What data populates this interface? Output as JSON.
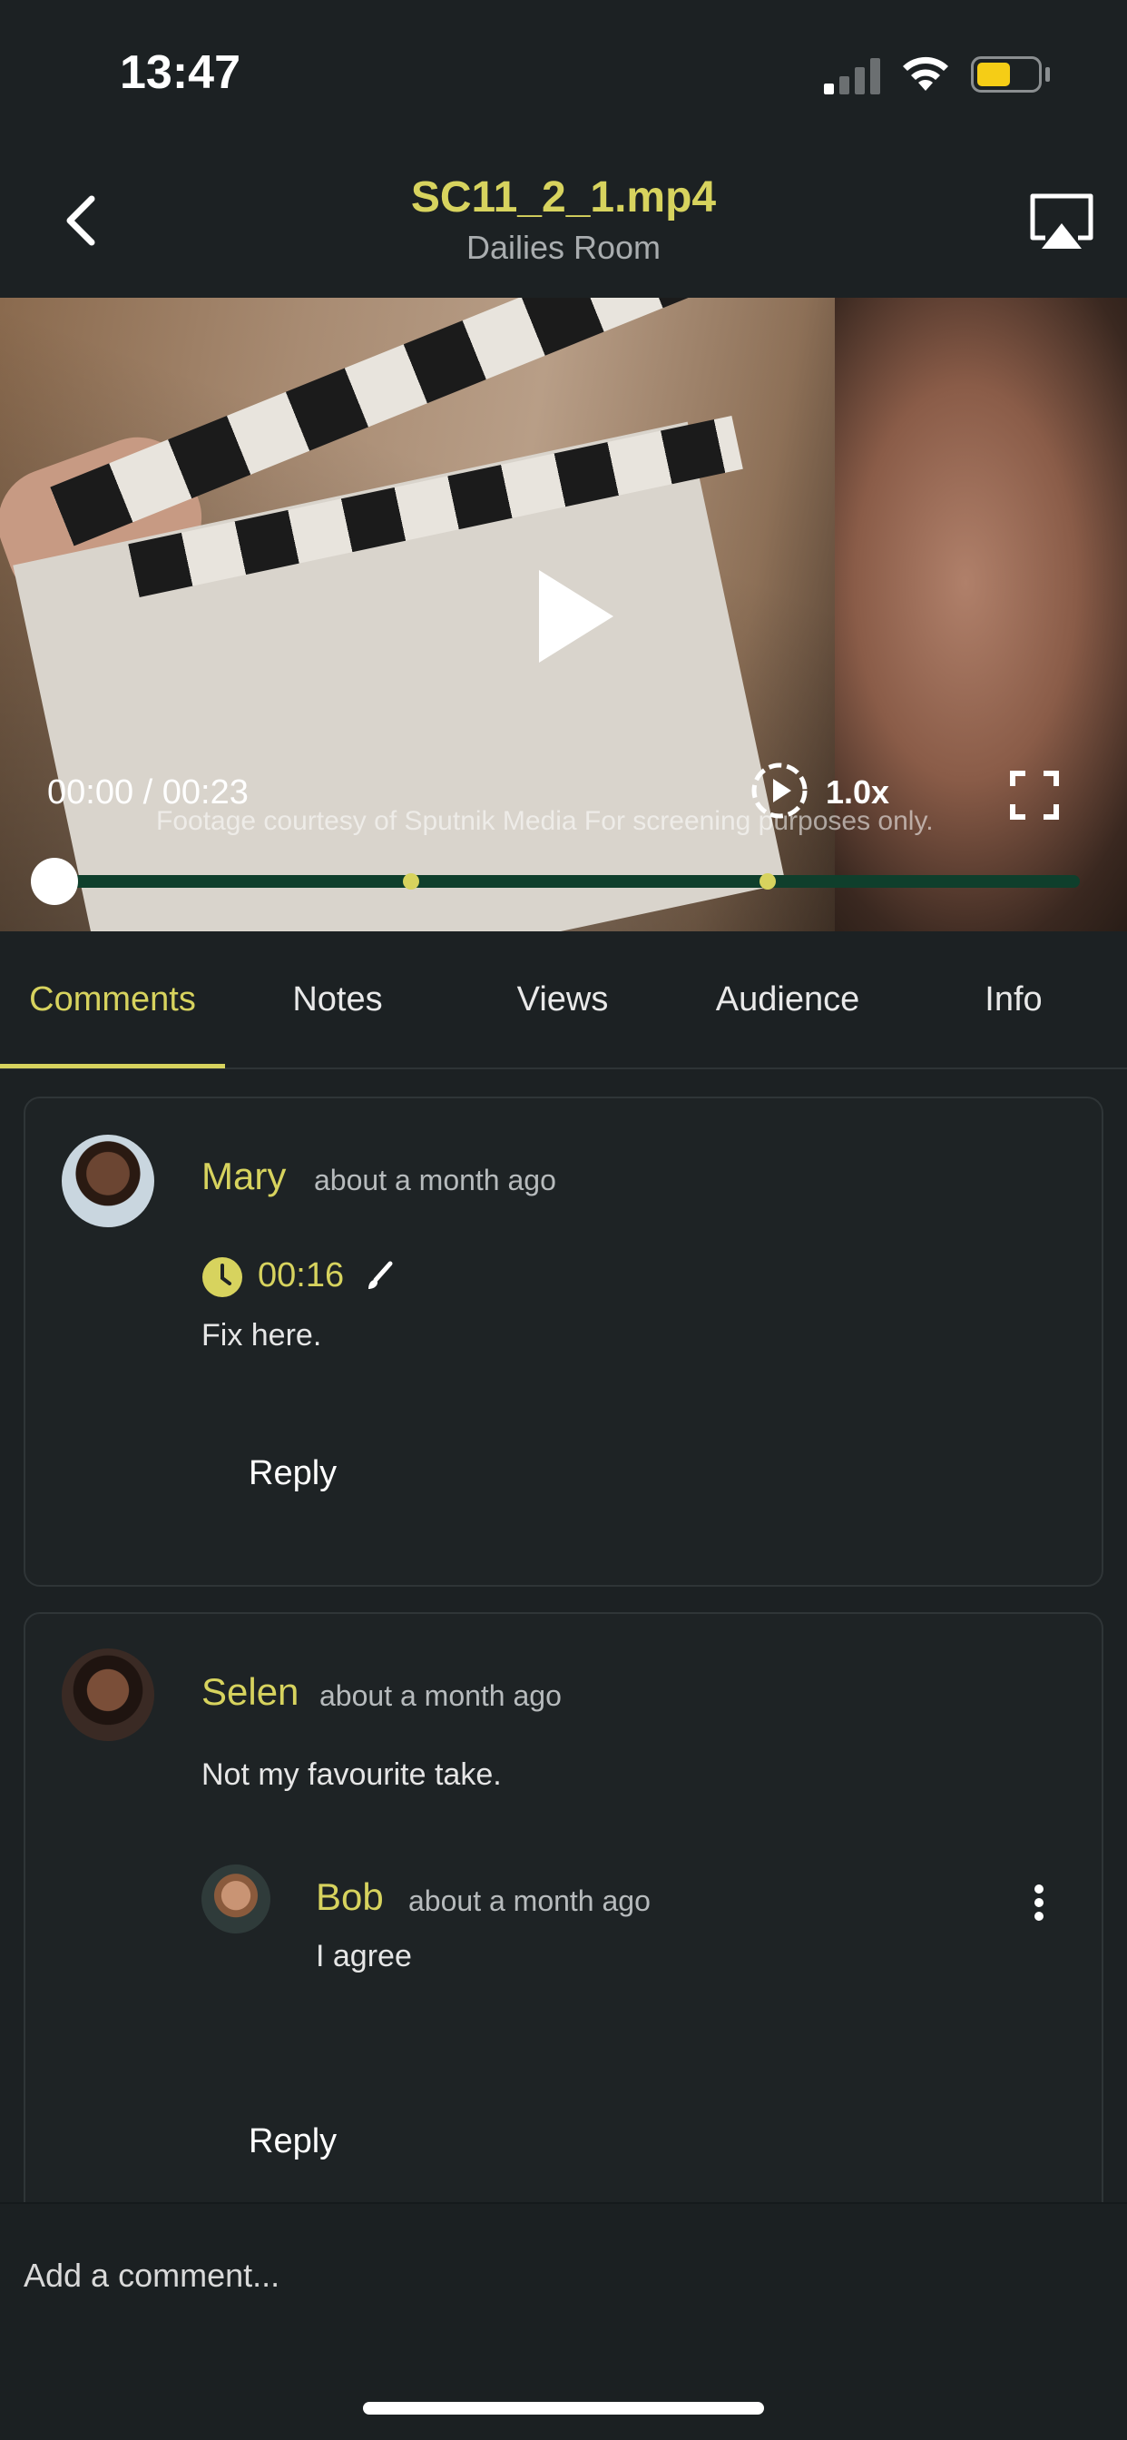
{
  "status_bar": {
    "time": "13:47",
    "battery_color": "#f5cd16"
  },
  "header": {
    "title": "SC11_2_1.mp4",
    "subtitle": "Dailies Room",
    "back_icon": "chevron-left-icon",
    "airplay_icon": "airplay-icon"
  },
  "player": {
    "time_readout": "00:00 / 00:23",
    "watermark": "Footage courtesy of Sputnik Media For screening purposes only.",
    "speed": "1.0x",
    "current_seconds": 0,
    "duration_seconds": 23,
    "comment_marker_seconds": [
      8,
      16
    ]
  },
  "tabs": [
    {
      "label": "Comments",
      "active": true
    },
    {
      "label": "Notes",
      "active": false
    },
    {
      "label": "Views",
      "active": false
    },
    {
      "label": "Audience",
      "active": false
    },
    {
      "label": "Info",
      "active": false
    }
  ],
  "comments": [
    {
      "author": "Mary",
      "time_ago": "about a month ago",
      "timecode": "00:16",
      "text": "Fix here.",
      "reply_label": "Reply"
    },
    {
      "author": "Selen",
      "time_ago": "about a month ago",
      "text": "Not my favourite take.",
      "replies": [
        {
          "author": "Bob",
          "time_ago": "about a month ago",
          "text": "I agree"
        }
      ],
      "reply_label": "Reply"
    }
  ],
  "composer": {
    "placeholder": "Add a comment..."
  },
  "colors": {
    "accent": "#d7d35e",
    "background": "#1c2123",
    "progress_track": "#0f3f2c"
  }
}
